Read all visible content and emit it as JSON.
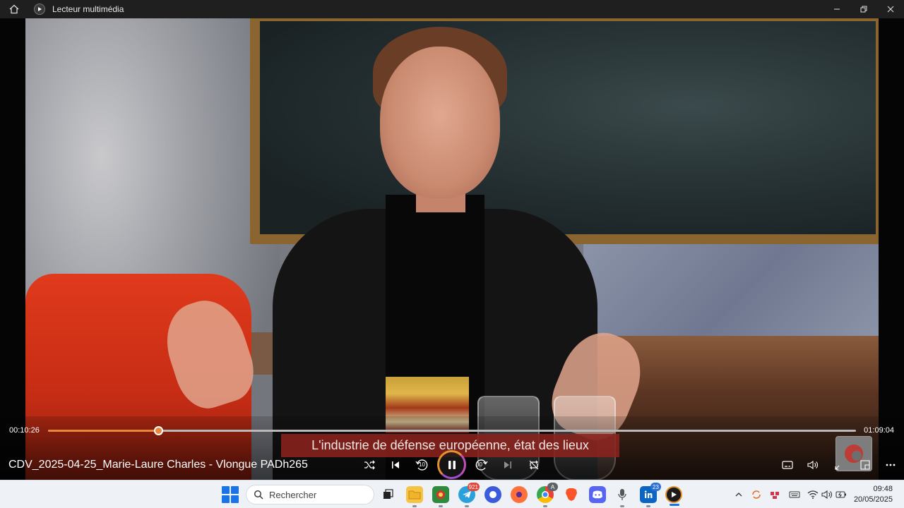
{
  "window": {
    "title": "Lecteur multimédia"
  },
  "player": {
    "elapsed": "00:10:26",
    "duration": "01:09:04",
    "progress_fraction": 0.1367,
    "subtitle": "L'industrie de défense européenne, état des lieux",
    "media_title": "CDV_2025-04-25_Marie-Laure Charles - Vlongue PADh265",
    "skip_back_seconds": "10",
    "skip_forward_seconds": "30",
    "accent_color": "#e8873a",
    "subtitle_bg": "#8b221e"
  },
  "taskbar": {
    "search_placeholder": "Rechercher",
    "telegram_badge": "921",
    "chrome_badge": "A",
    "linkedin_badge": "23",
    "time": "09:48",
    "date": "20/05/2025"
  }
}
